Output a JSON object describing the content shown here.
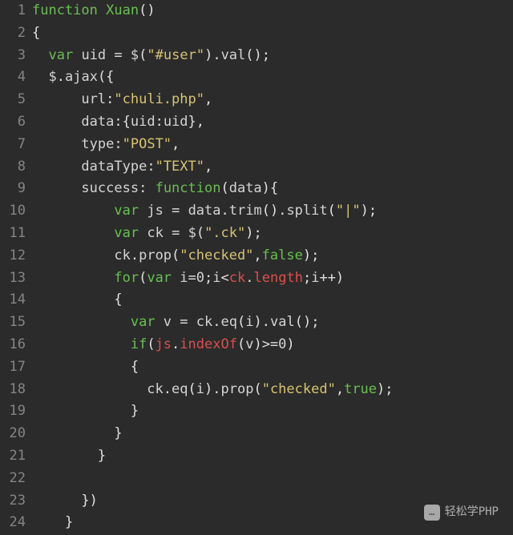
{
  "gutter": {
    "start": 1,
    "end": 24
  },
  "code": {
    "tokens": [
      [
        [
          "kw",
          "function"
        ],
        [
          "pl",
          " "
        ],
        [
          "fn",
          "Xuan"
        ],
        [
          "op",
          "()"
        ]
      ],
      [
        [
          "op",
          "{"
        ]
      ],
      [
        [
          "pl",
          "  "
        ],
        [
          "kw",
          "var"
        ],
        [
          "pl",
          " "
        ],
        [
          "id",
          "uid"
        ],
        [
          "pl",
          " "
        ],
        [
          "op",
          "="
        ],
        [
          "pl",
          " "
        ],
        [
          "id",
          "$"
        ],
        [
          "op",
          "("
        ],
        [
          "str",
          "\"#user\""
        ],
        [
          "op",
          ")."
        ],
        [
          "prop",
          "val"
        ],
        [
          "op",
          "();"
        ]
      ],
      [
        [
          "pl",
          "  "
        ],
        [
          "id",
          "$"
        ],
        [
          "op",
          "."
        ],
        [
          "prop",
          "ajax"
        ],
        [
          "op",
          "({"
        ]
      ],
      [
        [
          "pl",
          "      "
        ],
        [
          "prop",
          "url"
        ],
        [
          "op",
          ":"
        ],
        [
          "str",
          "\"chuli.php\""
        ],
        [
          "op",
          ","
        ]
      ],
      [
        [
          "pl",
          "      "
        ],
        [
          "prop",
          "data"
        ],
        [
          "op",
          ":{"
        ],
        [
          "id",
          "uid"
        ],
        [
          "op",
          ":"
        ],
        [
          "id",
          "uid"
        ],
        [
          "op",
          "},"
        ]
      ],
      [
        [
          "pl",
          "      "
        ],
        [
          "prop",
          "type"
        ],
        [
          "op",
          ":"
        ],
        [
          "str",
          "\"POST\""
        ],
        [
          "op",
          ","
        ]
      ],
      [
        [
          "pl",
          "      "
        ],
        [
          "prop",
          "dataType"
        ],
        [
          "op",
          ":"
        ],
        [
          "str",
          "\"TEXT\""
        ],
        [
          "op",
          ","
        ]
      ],
      [
        [
          "pl",
          "      "
        ],
        [
          "prop",
          "success"
        ],
        [
          "op",
          ":"
        ],
        [
          "pl",
          " "
        ],
        [
          "kw",
          "function"
        ],
        [
          "op",
          "("
        ],
        [
          "id",
          "data"
        ],
        [
          "op",
          "){"
        ]
      ],
      [
        [
          "pl",
          "          "
        ],
        [
          "kw",
          "var"
        ],
        [
          "pl",
          " "
        ],
        [
          "id",
          "js"
        ],
        [
          "pl",
          " "
        ],
        [
          "op",
          "="
        ],
        [
          "pl",
          " "
        ],
        [
          "id",
          "data"
        ],
        [
          "op",
          "."
        ],
        [
          "prop",
          "trim"
        ],
        [
          "op",
          "()."
        ],
        [
          "prop",
          "split"
        ],
        [
          "op",
          "("
        ],
        [
          "str",
          "\"|\""
        ],
        [
          "op",
          ");"
        ]
      ],
      [
        [
          "pl",
          "          "
        ],
        [
          "kw",
          "var"
        ],
        [
          "pl",
          " "
        ],
        [
          "id",
          "ck"
        ],
        [
          "pl",
          " "
        ],
        [
          "op",
          "="
        ],
        [
          "pl",
          " "
        ],
        [
          "id",
          "$"
        ],
        [
          "op",
          "("
        ],
        [
          "str",
          "\".ck\""
        ],
        [
          "op",
          ");"
        ]
      ],
      [
        [
          "pl",
          "          "
        ],
        [
          "id",
          "ck"
        ],
        [
          "op",
          "."
        ],
        [
          "prop",
          "prop"
        ],
        [
          "op",
          "("
        ],
        [
          "str",
          "\"checked\""
        ],
        [
          "op",
          ","
        ],
        [
          "kw",
          "false"
        ],
        [
          "op",
          ");"
        ]
      ],
      [
        [
          "pl",
          "          "
        ],
        [
          "kw",
          "for"
        ],
        [
          "op",
          "("
        ],
        [
          "kw",
          "var"
        ],
        [
          "pl",
          " "
        ],
        [
          "id",
          "i"
        ],
        [
          "op",
          "="
        ],
        [
          "num",
          "0"
        ],
        [
          "op",
          ";"
        ],
        [
          "id",
          "i"
        ],
        [
          "op",
          "<"
        ],
        [
          "red",
          "ck"
        ],
        [
          "op",
          "."
        ],
        [
          "red",
          "length"
        ],
        [
          "op",
          ";"
        ],
        [
          "id",
          "i"
        ],
        [
          "op",
          "++)"
        ]
      ],
      [
        [
          "pl",
          "          "
        ],
        [
          "op",
          "{"
        ]
      ],
      [
        [
          "pl",
          "            "
        ],
        [
          "kw",
          "var"
        ],
        [
          "pl",
          " "
        ],
        [
          "id",
          "v"
        ],
        [
          "pl",
          " "
        ],
        [
          "op",
          "="
        ],
        [
          "pl",
          " "
        ],
        [
          "id",
          "ck"
        ],
        [
          "op",
          "."
        ],
        [
          "prop",
          "eq"
        ],
        [
          "op",
          "("
        ],
        [
          "id",
          "i"
        ],
        [
          "op",
          ")."
        ],
        [
          "prop",
          "val"
        ],
        [
          "op",
          "();"
        ]
      ],
      [
        [
          "pl",
          "            "
        ],
        [
          "kw",
          "if"
        ],
        [
          "op",
          "("
        ],
        [
          "red",
          "js"
        ],
        [
          "op",
          "."
        ],
        [
          "red",
          "indexOf"
        ],
        [
          "op",
          "("
        ],
        [
          "id",
          "v"
        ],
        [
          "op",
          ")>="
        ],
        [
          "num",
          "0"
        ],
        [
          "op",
          ")"
        ]
      ],
      [
        [
          "pl",
          "            "
        ],
        [
          "op",
          "{"
        ]
      ],
      [
        [
          "pl",
          "              "
        ],
        [
          "id",
          "ck"
        ],
        [
          "op",
          "."
        ],
        [
          "prop",
          "eq"
        ],
        [
          "op",
          "("
        ],
        [
          "id",
          "i"
        ],
        [
          "op",
          ")."
        ],
        [
          "prop",
          "prop"
        ],
        [
          "op",
          "("
        ],
        [
          "str",
          "\"checked\""
        ],
        [
          "op",
          ","
        ],
        [
          "kw",
          "true"
        ],
        [
          "op",
          ");"
        ]
      ],
      [
        [
          "pl",
          "            "
        ],
        [
          "op",
          "}"
        ]
      ],
      [
        [
          "pl",
          "          "
        ],
        [
          "op",
          "}"
        ]
      ],
      [
        [
          "pl",
          "        "
        ],
        [
          "op",
          "}"
        ]
      ],
      [],
      [
        [
          "pl",
          "      "
        ],
        [
          "op",
          "})"
        ]
      ],
      [
        [
          "pl",
          "    "
        ],
        [
          "op",
          "}"
        ]
      ]
    ]
  },
  "watermark": {
    "icon": "…",
    "text": "轻松学PHP"
  }
}
